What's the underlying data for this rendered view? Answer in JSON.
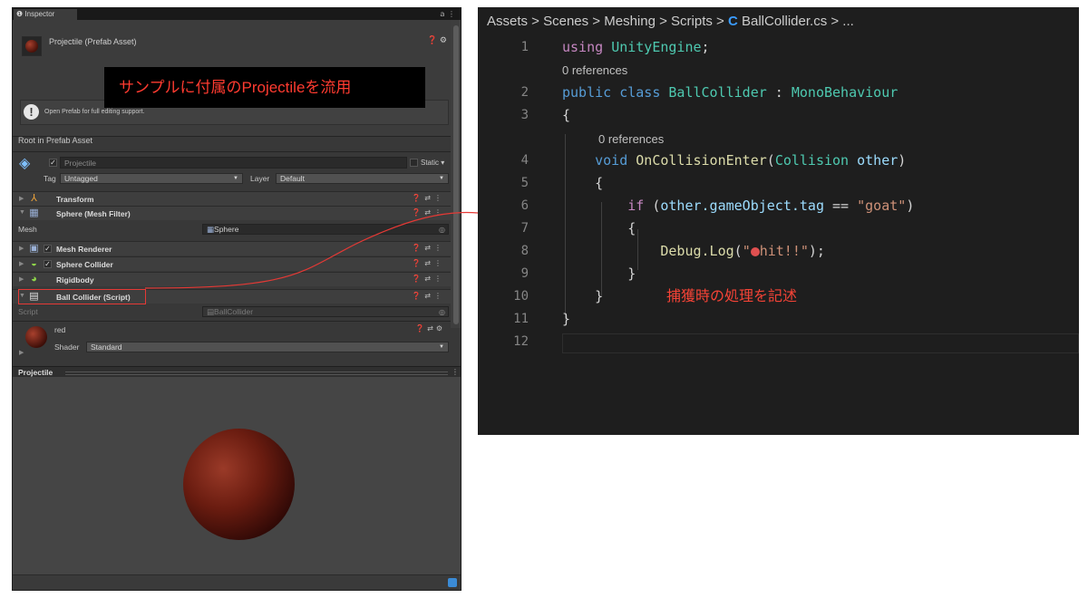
{
  "inspector": {
    "tab_label": "Inspector",
    "tab_icons": "⋮",
    "object_title": "Projectile (Prefab Asset)",
    "header_icons": "❓ ⚙",
    "callout_text": "サンプルに付属のProjectileを流用",
    "help_text": "Open Prefab for full editing support.",
    "root_label": "Root in Prefab Asset",
    "object_name": "Projectile",
    "static_label": "Static",
    "tag_label": "Tag",
    "tag_value": "Untagged",
    "layer_label": "Layer",
    "layer_value": "Default",
    "components": [
      {
        "name": "Transform",
        "icon": "transform-icon"
      },
      {
        "name": "Sphere (Mesh Filter)",
        "icon": "mesh-filter-icon"
      },
      {
        "name": "Mesh Renderer",
        "icon": "mesh-renderer-icon"
      },
      {
        "name": "Sphere Collider",
        "icon": "sphere-collider-icon"
      },
      {
        "name": "Rigidbody",
        "icon": "rigidbody-icon"
      },
      {
        "name": "Ball Collider (Script)",
        "icon": "script-icon"
      }
    ],
    "mesh_label": "Mesh",
    "mesh_value": "Sphere",
    "script_label": "Script",
    "script_value": "BallCollider",
    "material_name": "red",
    "shader_label": "Shader",
    "shader_value": "Standard",
    "preview_title": "Projectile",
    "accent_color": "#e53935"
  },
  "editor": {
    "breadcrumb": "Assets > Scenes > Meshing > Scripts > ",
    "breadcrumb_file": "BallCollider.cs",
    "breadcrumb_tail": " > ...",
    "breadcrumb_icon": "C#",
    "references": "0 references",
    "line_numbers": [
      "1",
      "2",
      "3",
      "4",
      "5",
      "6",
      "7",
      "8",
      "9",
      "10",
      "11",
      "12"
    ],
    "annotation": "捕獲時の処理を記述",
    "code": {
      "l1_kw": "using",
      "l1_ns": "UnityEngine",
      "l2_kw1": "public",
      "l2_kw2": "class",
      "l2_cls": "BallCollider",
      "l2_base": "MonoBehaviour",
      "l4_kw": "void",
      "l4_fn": "OnCollisionEnter",
      "l4_type": "Collision",
      "l4_param": "other",
      "l6_kw": "if",
      "l6_expr": "other.gameObject.tag",
      "l6_str": "\"goat\"",
      "l8_fn": "Debug.Log",
      "l8_str_open": "\"",
      "l8_str_rest": "hit!!\""
    }
  }
}
